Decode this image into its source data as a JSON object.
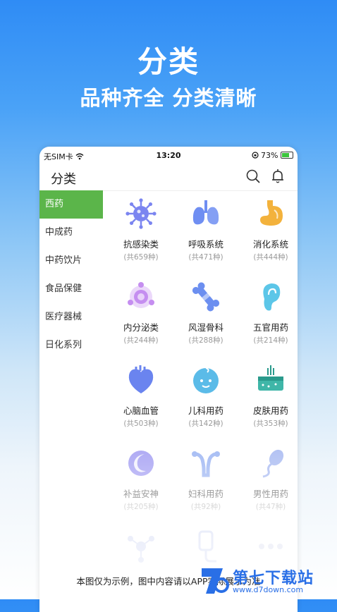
{
  "hero": {
    "title": "分类",
    "subtitle": "品种齐全 分类清晰"
  },
  "statusbar": {
    "carrier": "无SIM卡",
    "time": "13:20",
    "battery": "73%"
  },
  "appbar": {
    "title": "分类",
    "search_icon": "search-icon",
    "bell_icon": "bell-icon"
  },
  "sidebar": {
    "items": [
      {
        "label": "西药",
        "active": true
      },
      {
        "label": "中成药",
        "active": false
      },
      {
        "label": "中药饮片",
        "active": false
      },
      {
        "label": "食品保健",
        "active": false
      },
      {
        "label": "医疗器械",
        "active": false
      },
      {
        "label": "日化系列",
        "active": false
      }
    ]
  },
  "categories": [
    {
      "name": "抗感染类",
      "count": "(共659种)",
      "icon": "virus-icon",
      "color": "#7b85f0"
    },
    {
      "name": "呼吸系统",
      "count": "(共471种)",
      "icon": "lungs-icon",
      "color": "#6f8ef2"
    },
    {
      "name": "消化系统",
      "count": "(共444种)",
      "icon": "stomach-icon",
      "color": "#f3b23c"
    },
    {
      "name": "内分泌类",
      "count": "(共244种)",
      "icon": "endocrine-icon",
      "color": "#c58ef0"
    },
    {
      "name": "风湿骨科",
      "count": "(共288种)",
      "icon": "bone-icon",
      "color": "#6c8ff0"
    },
    {
      "name": "五官用药",
      "count": "(共214种)",
      "icon": "ear-icon",
      "color": "#5cc6e8"
    },
    {
      "name": "心脑血管",
      "count": "(共503种)",
      "icon": "heart-icon",
      "color": "#6a84ef"
    },
    {
      "name": "儿科用药",
      "count": "(共142种)",
      "icon": "baby-icon",
      "color": "#5bbbe8"
    },
    {
      "name": "皮肤用药",
      "count": "(共353种)",
      "icon": "skin-icon",
      "color": "#3fb6a8"
    },
    {
      "name": "补益安神",
      "count": "(共205种)",
      "icon": "moon-icon",
      "color": "#8a84ef"
    },
    {
      "name": "妇科用药",
      "count": "(共92种)",
      "icon": "uterus-icon",
      "color": "#7fa0f0"
    },
    {
      "name": "男性用药",
      "count": "(共47种)",
      "icon": "sperm-icon",
      "color": "#8fa6ee"
    },
    {
      "name": "",
      "count": "",
      "icon": "molecule-icon",
      "color": "#b9c3ee"
    },
    {
      "name": "",
      "count": "",
      "icon": "iv-drip-icon",
      "color": "#b9c3ee"
    },
    {
      "name": "",
      "count": "",
      "icon": "more-icon",
      "color": "#c7cde8"
    }
  ],
  "footer": {
    "disclaimer": "本图仅为示例，图中内容请以APP实际展示为准"
  },
  "watermark": {
    "text": "第七下载站",
    "url": "www.d7down.com"
  }
}
